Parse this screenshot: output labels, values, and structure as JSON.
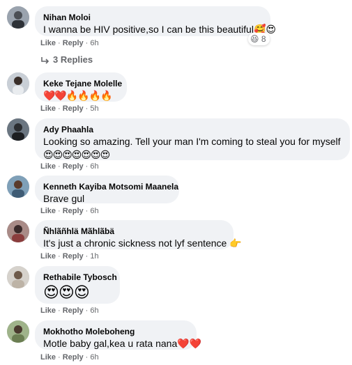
{
  "comments": [
    {
      "author": "Nihan Moloi",
      "text": "I wanna be HIV positive,so I can be this beautiful",
      "emojis": "🥰😍",
      "reaction_icon": "😆",
      "reaction_count": "8",
      "like": "Like",
      "reply": "Reply",
      "time": "6h",
      "replies_label": "3 Replies"
    },
    {
      "author": "Keke Tejane Molelle",
      "emojis": "❤️❤️🔥🔥🔥🔥",
      "like": "Like",
      "reply": "Reply",
      "time": "5h"
    },
    {
      "author": "Ady Phaahla",
      "text": "Looking so amazing. Tell your man I'm coming to steal you for myself",
      "emojis": "😍😍😍😍😍😍😍",
      "like": "Like",
      "reply": "Reply",
      "time": "6h"
    },
    {
      "author": "Kenneth Kayiba Motsomi Maanela",
      "text": "Brave gul",
      "like": "Like",
      "reply": "Reply",
      "time": "6h"
    },
    {
      "author": "Ñhlãñhlä Mãhlãbä",
      "text": "It's just a chronic sickness not lyf sentence",
      "emojis": "👉",
      "like": "Like",
      "reply": "Reply",
      "time": "1h"
    },
    {
      "author": "Rethabile Tybosch",
      "emojis": "😍😍😍",
      "like": "Like",
      "reply": "Reply",
      "time": "6h"
    },
    {
      "author": "Mokhotho Moleboheng",
      "text": "Motle baby gal,kea u rata nana",
      "emojis": "❤️❤️",
      "like": "Like",
      "reply": "Reply",
      "time": "6h"
    }
  ],
  "colors": {
    "bubble_bg": "#f0f2f5",
    "meta_text": "#65676b",
    "name_text": "#050505"
  }
}
